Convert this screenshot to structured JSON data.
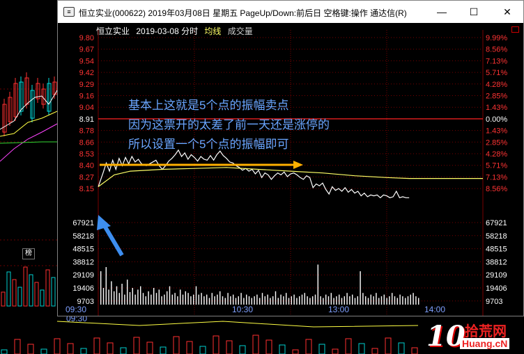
{
  "window": {
    "title": "恒立实业(000622) 2019年03月08日 星期五 PageUp/Down:前后日 空格键:操作 通达信(R)",
    "minimize": "—",
    "maximize": "☐",
    "close": "✕"
  },
  "info_bar": {
    "stock": "恒立实业",
    "date_label": "2019-03-08 分时",
    "avg_label": "均线",
    "vol_label": "成交量"
  },
  "annotation_lines": [
    "基本上这就是5个点的振幅卖点",
    "因为这票开的太差了前一天还是涨停的",
    "所以设置一个5个点的振幅即可"
  ],
  "background_chart": {
    "glyph": "榜",
    "time_labels": [
      "09:30"
    ]
  },
  "watermark": {
    "number": "10",
    "cn": "拾荒网",
    "en": "Huang.cN"
  },
  "colors": {
    "price_axis": "#ff3333",
    "volume_axis": "#ffffff",
    "grid": "#7a0000",
    "prev_close": "#ff2222",
    "price_line": "#ffffff",
    "avg_line": "#ffff66",
    "arrow_yellow": "#ffb000",
    "arrow_blue": "#3d8ef0",
    "annotation": "#6aa6ff",
    "time_label": "#7fa0ff"
  },
  "chart_data": {
    "type": "line",
    "title": "恒立实业 2019-03-08 分时",
    "prev_close": 8.91,
    "price_ticks": [
      "9.80",
      "9.67",
      "9.54",
      "9.42",
      "9.29",
      "9.16",
      "9.04",
      "8.91",
      "8.78",
      "8.66",
      "8.53",
      "8.40",
      "8.27",
      "8.15"
    ],
    "pct_ticks": [
      "9.99%",
      "8.56%",
      "7.13%",
      "5.71%",
      "4.28%",
      "2.85%",
      "1.43%",
      "0.00%",
      "1.43%",
      "2.85%",
      "4.28%",
      "5.71%",
      "7.13%",
      "8.56%"
    ],
    "volume_ticks": [
      "67921",
      "58218",
      "48515",
      "38812",
      "29109",
      "19406",
      "9703"
    ],
    "time_labels": [
      "09:30",
      "10:30",
      "13:00",
      "14:00"
    ],
    "ylim": [
      8.15,
      9.8
    ],
    "x_minutes_total": 240,
    "series": [
      {
        "name": "成交价",
        "points": [
          [
            0,
            8.17
          ],
          [
            3,
            8.32
          ],
          [
            5,
            8.43
          ],
          [
            7,
            8.34
          ],
          [
            9,
            8.46
          ],
          [
            11,
            8.36
          ],
          [
            13,
            8.48
          ],
          [
            15,
            8.4
          ],
          [
            17,
            8.49
          ],
          [
            19,
            8.42
          ],
          [
            21,
            8.5
          ],
          [
            23,
            8.44
          ],
          [
            25,
            8.47
          ],
          [
            27,
            8.42
          ],
          [
            30,
            8.4
          ],
          [
            33,
            8.43
          ],
          [
            36,
            8.46
          ],
          [
            38,
            8.4
          ],
          [
            40,
            8.36
          ],
          [
            42,
            8.4
          ],
          [
            44,
            8.45
          ],
          [
            46,
            8.48
          ],
          [
            48,
            8.52
          ],
          [
            50,
            8.57
          ],
          [
            52,
            8.5
          ],
          [
            54,
            8.54
          ],
          [
            56,
            8.47
          ],
          [
            58,
            8.52
          ],
          [
            60,
            8.49
          ],
          [
            62,
            8.45
          ],
          [
            64,
            8.5
          ],
          [
            66,
            8.47
          ],
          [
            68,
            8.46
          ],
          [
            70,
            8.51
          ],
          [
            72,
            8.46
          ],
          [
            74,
            8.52
          ],
          [
            76,
            8.56
          ],
          [
            78,
            8.51
          ],
          [
            80,
            8.48
          ],
          [
            82,
            8.44
          ],
          [
            84,
            8.43
          ],
          [
            86,
            8.4
          ],
          [
            88,
            8.38
          ],
          [
            90,
            8.35
          ],
          [
            92,
            8.37
          ],
          [
            94,
            8.34
          ],
          [
            96,
            8.36
          ],
          [
            98,
            8.31
          ],
          [
            100,
            8.35
          ],
          [
            102,
            8.27
          ],
          [
            104,
            8.32
          ],
          [
            106,
            8.3
          ],
          [
            108,
            8.25
          ],
          [
            110,
            8.29
          ],
          [
            112,
            8.32
          ],
          [
            114,
            8.3
          ],
          [
            116,
            8.33
          ],
          [
            118,
            8.28
          ],
          [
            120,
            8.31
          ],
          [
            122,
            8.32
          ],
          [
            124,
            8.3
          ],
          [
            126,
            8.27
          ],
          [
            128,
            8.25
          ],
          [
            130,
            8.29
          ],
          [
            132,
            8.27
          ],
          [
            134,
            8.16
          ],
          [
            136,
            8.2
          ],
          [
            138,
            8.18
          ],
          [
            140,
            8.21
          ],
          [
            142,
            8.14
          ],
          [
            144,
            8.09
          ],
          [
            146,
            8.17
          ],
          [
            148,
            8.13
          ],
          [
            150,
            8.15
          ],
          [
            152,
            8.12
          ],
          [
            154,
            8.16
          ],
          [
            156,
            8.11
          ],
          [
            158,
            8.14
          ],
          [
            160,
            8.1
          ],
          [
            162,
            8.12
          ],
          [
            164,
            8.07
          ],
          [
            166,
            8.1
          ],
          [
            168,
            8.06
          ],
          [
            170,
            8.08
          ],
          [
            172,
            8.07
          ],
          [
            174,
            8.08
          ],
          [
            176,
            8.05
          ],
          [
            178,
            8.08
          ],
          [
            180,
            8.07
          ],
          [
            182,
            8.05
          ],
          [
            184,
            8.06
          ],
          [
            186,
            8.12
          ],
          [
            188,
            8.05
          ],
          [
            190,
            8.06
          ],
          [
            192,
            8.05
          ],
          [
            194,
            8.05
          ]
        ]
      },
      {
        "name": "均线",
        "points": [
          [
            0,
            8.17
          ],
          [
            10,
            8.3
          ],
          [
            20,
            8.34
          ],
          [
            40,
            8.36
          ],
          [
            60,
            8.37
          ],
          [
            80,
            8.38
          ],
          [
            100,
            8.36
          ],
          [
            120,
            8.34
          ],
          [
            140,
            8.32
          ],
          [
            160,
            8.29
          ],
          [
            180,
            8.27
          ],
          [
            194,
            8.26
          ],
          [
            240,
            8.26
          ]
        ]
      }
    ],
    "volume": [
      40,
      20,
      45,
      18,
      28,
      16,
      22,
      14,
      25,
      12,
      30,
      15,
      20,
      12,
      18,
      22,
      14,
      10,
      16,
      12,
      20,
      14,
      18,
      10,
      12,
      16,
      22,
      12,
      14,
      10,
      18,
      12,
      16,
      14,
      10,
      12,
      22,
      12,
      14,
      10,
      12,
      8,
      14,
      10,
      12,
      16,
      10,
      8,
      14,
      10,
      12,
      8,
      10,
      14,
      8,
      12,
      10,
      8,
      10,
      12,
      8,
      14,
      10,
      12,
      8,
      10,
      16,
      8,
      12,
      10,
      14,
      8,
      10,
      12,
      8,
      10,
      12,
      14,
      10,
      8,
      10,
      12,
      48,
      10,
      8,
      12,
      10,
      14,
      8,
      10,
      12,
      8,
      10,
      14,
      10,
      12,
      8,
      10,
      40,
      14,
      10,
      8,
      12,
      10,
      14,
      8,
      10,
      12,
      8,
      10,
      14,
      10,
      8,
      12,
      10,
      8,
      10,
      12,
      14,
      10,
      8
    ],
    "annotations": [
      "yellow arrow pointing right at ~8.53",
      "blue arrow pointing up-left at open 8.15"
    ]
  }
}
